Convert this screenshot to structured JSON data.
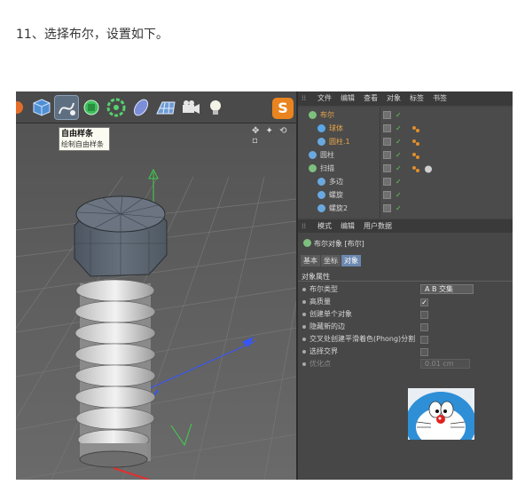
{
  "caption": "11、选择布尔，设置如下。",
  "tooltip": {
    "title": "自由样条",
    "desc": "绘制自由样条"
  },
  "toolbar": {
    "logo_letter": "S"
  },
  "object_manager": {
    "menu": [
      "文件",
      "编辑",
      "查看",
      "对象",
      "标签",
      "书签"
    ],
    "rows": [
      {
        "name": "布尔",
        "indent": 0,
        "color": "#e8a64a",
        "icon": "boole-icon"
      },
      {
        "name": "球体",
        "indent": 1,
        "color": "#e8a64a",
        "icon": "sphere-icon"
      },
      {
        "name": "圆柱.1",
        "indent": 1,
        "color": "#e8a64a",
        "icon": "cylinder-icon"
      },
      {
        "name": "圆柱",
        "indent": 0,
        "color": "#d4d4d4",
        "icon": "cylinder-icon"
      },
      {
        "name": "扫描",
        "indent": 0,
        "color": "#d4d4d4",
        "icon": "sweep-icon"
      },
      {
        "name": "多边",
        "indent": 1,
        "color": "#d4d4d4",
        "icon": "spline-icon"
      },
      {
        "name": "螺旋",
        "indent": 1,
        "color": "#d4d4d4",
        "icon": "helix-icon"
      },
      {
        "name": "螺旋2",
        "indent": 1,
        "color": "#d4d4d4",
        "icon": "helix-icon"
      }
    ]
  },
  "attributes": {
    "menu": [
      "模式",
      "编辑",
      "用户数据"
    ],
    "title": "布尔对象 [布尔]",
    "tabs": [
      "基本",
      "坐标",
      "对象"
    ],
    "active_tab": "对象",
    "section": "对象属性",
    "props": [
      {
        "label": "布尔类型",
        "type": "dropdown",
        "value": "A B 交集"
      },
      {
        "label": "高质量",
        "type": "checkbox",
        "checked": true
      },
      {
        "label": "创建单个对象",
        "type": "checkbox",
        "checked": false
      },
      {
        "label": "隐藏新的边",
        "type": "checkbox",
        "checked": false
      },
      {
        "label": "交叉处创建平滑着色(Phong)分割",
        "type": "checkbox",
        "checked": false
      },
      {
        "label": "选择交界",
        "type": "checkbox",
        "checked": false
      },
      {
        "label": "优化点",
        "type": "number",
        "value": "0.01 cm",
        "disabled": true
      }
    ]
  }
}
